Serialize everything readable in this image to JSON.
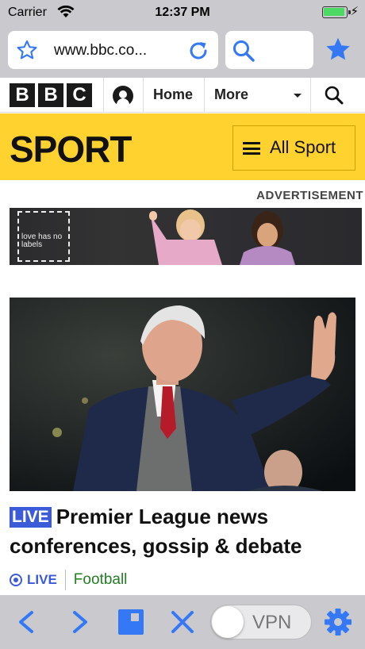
{
  "status_bar": {
    "carrier": "Carrier",
    "time": "12:37 PM"
  },
  "browser": {
    "url": "www.bbc.co...",
    "colors": {
      "accent": "#3478f6",
      "chrome": "#c9c9ce"
    }
  },
  "bbc_nav": {
    "logo_letters": [
      "B",
      "B",
      "C"
    ],
    "home_label": "Home",
    "more_label": "More"
  },
  "sport_header": {
    "title": "SPORT",
    "all_sport_label": "All Sport",
    "color": "#ffd230"
  },
  "advertisement": {
    "label": "ADVERTISEMENT",
    "box_text": "love has no labels"
  },
  "article": {
    "live_tag": "LIVE",
    "headline": "Premier League news conferences, gossip & debate",
    "status": "LIVE",
    "topic": "Football"
  },
  "bottom_toolbar": {
    "vpn_label": "VPN",
    "icons": [
      "back-icon",
      "forward-icon",
      "tabs-icon",
      "close-icon",
      "vpn-toggle",
      "settings-gear-icon"
    ]
  }
}
